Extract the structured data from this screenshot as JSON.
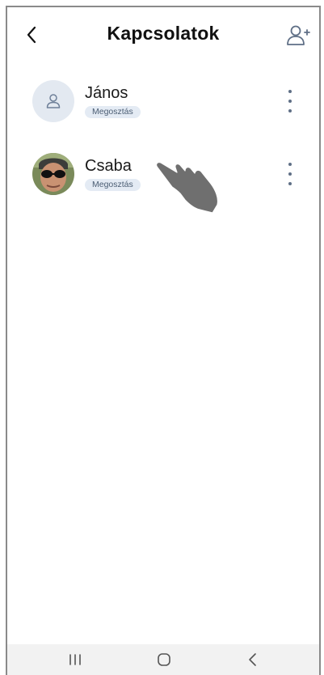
{
  "header": {
    "title": "Kapcsolatok",
    "back_icon": "chevron-left-icon",
    "add_icon": "person-add-icon"
  },
  "contacts": [
    {
      "name": "János",
      "badge": "Megosztás",
      "avatar": "person-placeholder-icon"
    },
    {
      "name": "Csaba",
      "badge": "Megosztás",
      "avatar": "photo-avatar"
    }
  ],
  "navbar": {
    "recent_icon": "recent-apps-icon",
    "home_icon": "home-icon",
    "back_icon": "nav-back-icon"
  },
  "colors": {
    "badge_bg": "#e4ebf4",
    "badge_text": "#4b5d73",
    "menu_dots": "#5f6f86",
    "avatar_placeholder_bg": "#e3e9f1"
  }
}
